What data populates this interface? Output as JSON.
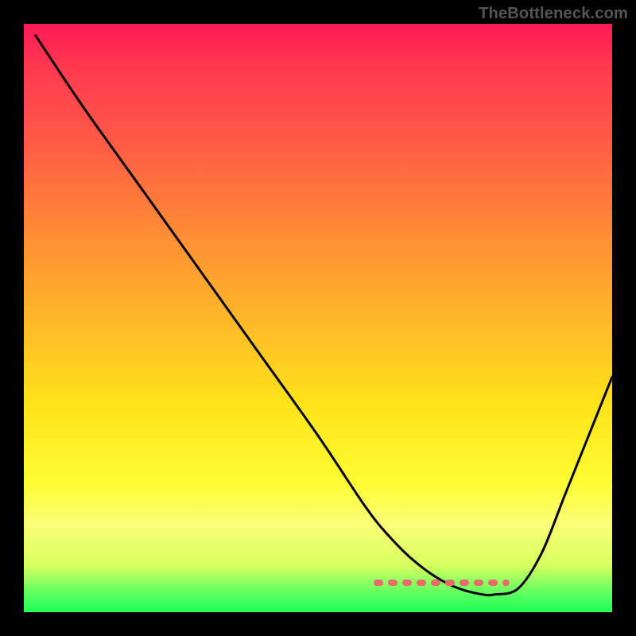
{
  "watermark": "TheBottleneck.com",
  "chart_data": {
    "type": "line",
    "title": "",
    "xlabel": "",
    "ylabel": "",
    "xlim": [
      0,
      100
    ],
    "ylim": [
      0,
      100
    ],
    "series": [
      {
        "name": "bottleneck-curve",
        "x": [
          2,
          10,
          20,
          30,
          40,
          50,
          58,
          62,
          66,
          70,
          74,
          78,
          80,
          84,
          88,
          92,
          96,
          100
        ],
        "y": [
          98,
          86,
          72,
          58,
          44,
          30,
          18,
          13,
          9,
          6,
          4,
          3,
          3,
          4,
          10,
          20,
          30,
          40
        ]
      }
    ],
    "annotations": [
      {
        "name": "optimal-zone-marker",
        "type": "dashed-segment",
        "xrange": [
          60,
          82
        ],
        "y": 5,
        "color": "#e86a6a"
      }
    ],
    "gradient_stops": [
      {
        "pos": 0,
        "color": "#ff1a55"
      },
      {
        "pos": 50,
        "color": "#ffb728"
      },
      {
        "pos": 85,
        "color": "#faff76"
      },
      {
        "pos": 100,
        "color": "#1aff55"
      }
    ]
  }
}
